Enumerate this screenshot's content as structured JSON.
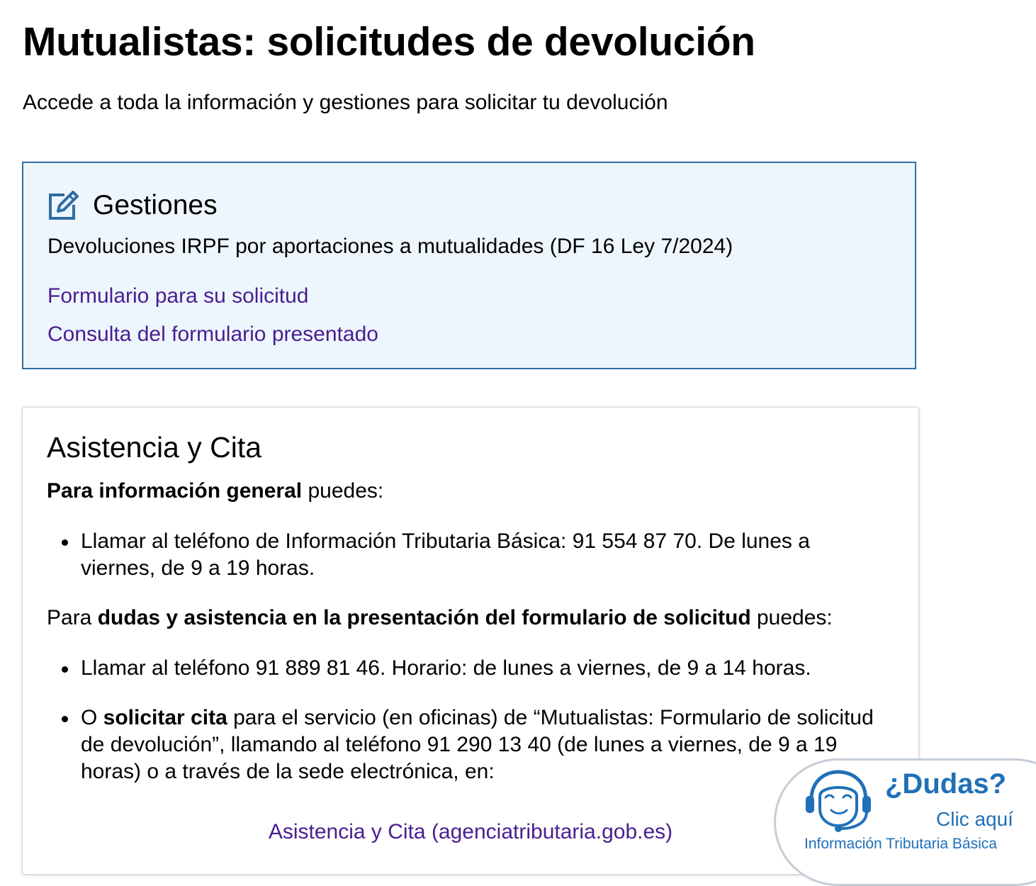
{
  "page": {
    "title": "Mutualistas: solicitudes de devolución",
    "subtitle": "Accede a toda la información y gestiones para solicitar tu devolución"
  },
  "gestiones": {
    "icon": "edit-icon",
    "title": "Gestiones",
    "description": "Devoluciones IRPF por aportaciones a mutualidades (DF 16 Ley 7/2024)",
    "links": [
      "Formulario para su solicitud",
      "Consulta del formulario presentado"
    ]
  },
  "asistencia": {
    "title": "Asistencia y Cita",
    "info_general": {
      "bold": "Para información general",
      "rest": " puedes:"
    },
    "bullet1": "Llamar al teléfono de Información Tributaria Básica: 91 554 87 70. De lunes a viernes, de 9 a 19 horas.",
    "dudas_intro": {
      "prefix": "Para ",
      "bold": "dudas y asistencia en la presentación del formulario de solicitud",
      "suffix": " puedes:"
    },
    "bullet2": "Llamar al teléfono 91 889 81 46. Horario: de lunes a viernes, de 9 a 14 horas.",
    "bullet3": {
      "prefix": "O ",
      "bold": "solicitar cita",
      "rest": " para el servicio (en oficinas) de “Mutualistas: Formulario de solicitud de devolución”, llamando al teléfono 91 290 13 40 (de lunes a viernes, de 9 a 19 horas) o a través de la sede electrónica, en:"
    },
    "link": "Asistencia y Cita (agenciatributaria.gob.es)"
  },
  "dudas_widget": {
    "icon": "support-agent-icon",
    "title": "¿Dudas?",
    "subtitle": "Clic aquí",
    "footer": "Información Tributaria Básica"
  },
  "colors": {
    "link": "#4a1d91",
    "box_border": "#2f6da3",
    "box_background": "#eef6fd",
    "widget_blue": "#1f70b8"
  }
}
